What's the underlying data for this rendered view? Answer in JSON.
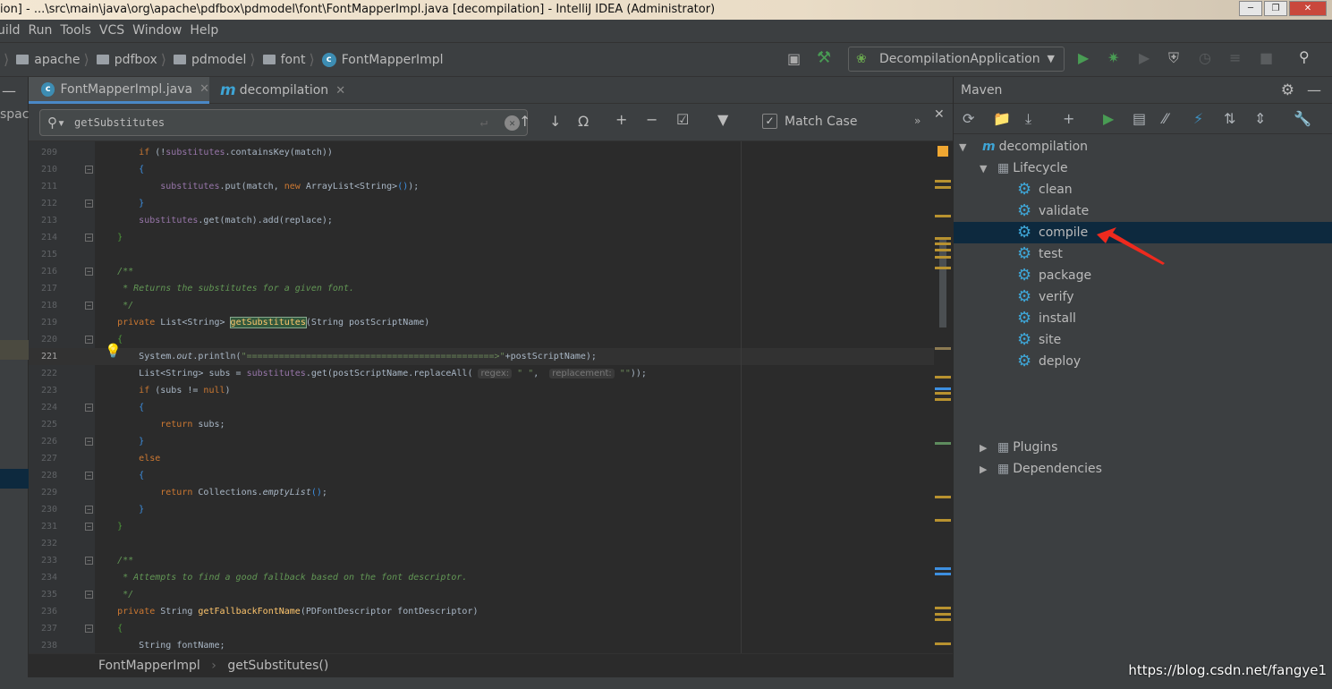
{
  "title_bar": {
    "text": "ion] - ...\\src\\main\\java\\org\\apache\\pdfbox\\pdmodel\\font\\FontMapperImpl.java [decompilation] - IntelliJ IDEA (Administrator)"
  },
  "menu": [
    "uild",
    "Run",
    "Tools",
    "VCS",
    "Window",
    "Help"
  ],
  "breadcrumb": [
    "apache",
    "pdfbox",
    "pdmodel",
    "font",
    "FontMapperImpl"
  ],
  "run_config": {
    "label": "DecompilationApplication"
  },
  "left_strip_label": "spac",
  "tabs": [
    {
      "label": "FontMapperImpl.java",
      "active": true
    },
    {
      "label": "decompilation",
      "active": false
    }
  ],
  "search": {
    "value": "getSubstitutes",
    "match_case_label": "Match Case",
    "match_case_checked": true,
    "more": "»"
  },
  "editor": {
    "current_line": 221,
    "lines": [
      {
        "n": 209,
        "t": [
          [
            "",
            "        "
          ],
          [
            "kw",
            "if "
          ],
          [
            "txt",
            "(!"
          ],
          [
            "fld",
            "substitutes"
          ],
          [
            "txt",
            ".containsKey(match))"
          ]
        ]
      },
      {
        "n": 210,
        "f": 1,
        "t": [
          [
            "",
            "        "
          ],
          [
            "br",
            "{"
          ]
        ]
      },
      {
        "n": 211,
        "t": [
          [
            "",
            "            "
          ],
          [
            "fld",
            "substitutes"
          ],
          [
            "txt",
            ".put(match, "
          ],
          [
            "kw",
            "new "
          ],
          [
            "txt",
            "ArrayList<String>"
          ],
          [
            "br",
            "()"
          ],
          [
            "txt",
            ");"
          ]
        ]
      },
      {
        "n": 212,
        "f": 1,
        "t": [
          [
            "",
            "        "
          ],
          [
            "br",
            "}"
          ]
        ]
      },
      {
        "n": 213,
        "t": [
          [
            "",
            "        "
          ],
          [
            "fld",
            "substitutes"
          ],
          [
            "txt",
            ".get(match).add(replace);"
          ]
        ]
      },
      {
        "n": 214,
        "f": 1,
        "t": [
          [
            "",
            "    "
          ],
          [
            "brg",
            "}"
          ]
        ]
      },
      {
        "n": 215,
        "t": []
      },
      {
        "n": 216,
        "f": 1,
        "t": [
          [
            "",
            "    "
          ],
          [
            "cm",
            "/**"
          ]
        ]
      },
      {
        "n": 217,
        "t": [
          [
            "",
            "    "
          ],
          [
            "cm",
            " * Returns the substitutes for a given font."
          ]
        ]
      },
      {
        "n": 218,
        "f": 1,
        "t": [
          [
            "",
            "    "
          ],
          [
            "cm",
            " */"
          ]
        ]
      },
      {
        "n": 219,
        "t": [
          [
            "",
            "    "
          ],
          [
            "kw",
            "private "
          ],
          [
            "txt",
            "List<String> "
          ],
          [
            "hl",
            "getSubstitutes"
          ],
          [
            "txt",
            "(String postScriptName)"
          ]
        ]
      },
      {
        "n": 220,
        "f": 1,
        "t": [
          [
            "",
            "    "
          ],
          [
            "brg",
            "{"
          ]
        ]
      },
      {
        "n": 221,
        "t": [
          [
            "",
            "        "
          ],
          [
            "txt",
            "System."
          ],
          [
            "fld it",
            "out"
          ],
          [
            "txt",
            ".println("
          ],
          [
            "str",
            "\"==============================================>\""
          ],
          [
            "txt",
            "+postScriptName);"
          ]
        ]
      },
      {
        "n": 222,
        "t": [
          [
            "",
            "        "
          ],
          [
            "txt",
            "List<String> subs = "
          ],
          [
            "fld",
            "substitutes"
          ],
          [
            "txt",
            ".get(postScriptName.replaceAll( "
          ],
          [
            "hint",
            "regex:"
          ],
          [
            "str",
            " \" \""
          ],
          [
            "txt",
            ",  "
          ],
          [
            "hint",
            "replacement:"
          ],
          [
            "str",
            " \"\""
          ],
          [
            "txt",
            "));"
          ]
        ]
      },
      {
        "n": 223,
        "t": [
          [
            "",
            "        "
          ],
          [
            "kw",
            "if "
          ],
          [
            "txt",
            "(subs != "
          ],
          [
            "kw",
            "null"
          ],
          [
            "txt",
            ")"
          ]
        ]
      },
      {
        "n": 224,
        "f": 1,
        "t": [
          [
            "",
            "        "
          ],
          [
            "br",
            "{"
          ]
        ]
      },
      {
        "n": 225,
        "t": [
          [
            "",
            "            "
          ],
          [
            "kw",
            "return "
          ],
          [
            "txt",
            "subs;"
          ]
        ]
      },
      {
        "n": 226,
        "f": 1,
        "t": [
          [
            "",
            "        "
          ],
          [
            "br",
            "}"
          ]
        ]
      },
      {
        "n": 227,
        "t": [
          [
            "",
            "        "
          ],
          [
            "kw",
            "else"
          ]
        ]
      },
      {
        "n": 228,
        "f": 1,
        "t": [
          [
            "",
            "        "
          ],
          [
            "br",
            "{"
          ]
        ]
      },
      {
        "n": 229,
        "t": [
          [
            "",
            "            "
          ],
          [
            "kw",
            "return "
          ],
          [
            "txt",
            "Collections."
          ],
          [
            "it",
            "emptyList"
          ],
          [
            "br",
            "()"
          ],
          [
            "txt",
            ";"
          ]
        ]
      },
      {
        "n": 230,
        "f": 1,
        "t": [
          [
            "",
            "        "
          ],
          [
            "br",
            "}"
          ]
        ]
      },
      {
        "n": 231,
        "f": 1,
        "t": [
          [
            "",
            "    "
          ],
          [
            "brg",
            "}"
          ]
        ]
      },
      {
        "n": 232,
        "t": []
      },
      {
        "n": 233,
        "f": 1,
        "t": [
          [
            "",
            "    "
          ],
          [
            "cm",
            "/**"
          ]
        ]
      },
      {
        "n": 234,
        "t": [
          [
            "",
            "    "
          ],
          [
            "cm",
            " * Attempts to find a good fallback based on the font descriptor."
          ]
        ]
      },
      {
        "n": 235,
        "f": 1,
        "t": [
          [
            "",
            "    "
          ],
          [
            "cm",
            " */"
          ]
        ]
      },
      {
        "n": 236,
        "t": [
          [
            "",
            "    "
          ],
          [
            "kw",
            "private "
          ],
          [
            "txt",
            "String "
          ],
          [
            "fn",
            "getFallbackFontName"
          ],
          [
            "txt",
            "(PDFontDescriptor fontDescriptor)"
          ]
        ]
      },
      {
        "n": 237,
        "f": 1,
        "t": [
          [
            "",
            "    "
          ],
          [
            "brg",
            "{"
          ]
        ]
      },
      {
        "n": 238,
        "t": [
          [
            "",
            "        "
          ],
          [
            "txt",
            "String fontName;"
          ]
        ]
      }
    ]
  },
  "bottom_breadcrumb": [
    "FontMapperImpl",
    "getSubstitutes()"
  ],
  "maven": {
    "title": "Maven",
    "project": "decompilation",
    "lifecycle_label": "Lifecycle",
    "phases": [
      "clean",
      "validate",
      "compile",
      "test",
      "package",
      "verify",
      "install",
      "site",
      "deploy"
    ],
    "selected": "compile",
    "plugins_label": "Plugins",
    "dependencies_label": "Dependencies"
  },
  "colors": {
    "accent": "#4a88c7",
    "selection": "#0d293e",
    "gear": "#3ea5d6",
    "annotation_arrow": "#ee2a1e",
    "run_green": "#499c54"
  },
  "watermark": "https://blog.csdn.net/fangye1"
}
